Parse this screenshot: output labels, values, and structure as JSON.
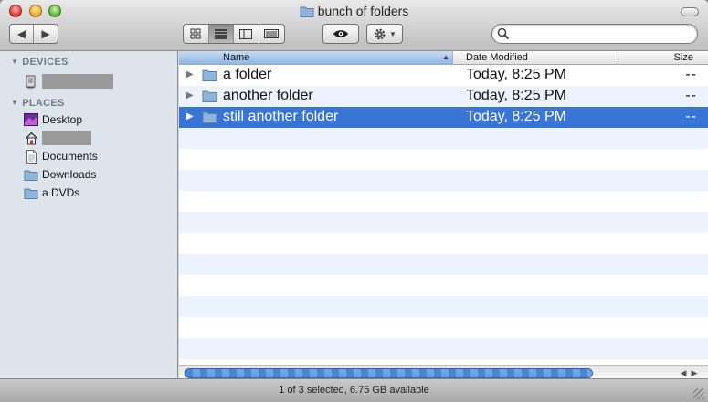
{
  "window": {
    "title": "bunch of folders"
  },
  "toolbar": {
    "back": "◀",
    "forward": "▶",
    "views": [
      "icon-view",
      "list-view",
      "column-view",
      "coverflow-view"
    ],
    "active_view": 1,
    "search": {
      "value": "",
      "placeholder": ""
    }
  },
  "sidebar": {
    "devices_header": "DEVICES",
    "places_header": "PLACES",
    "places": [
      {
        "label": "Desktop",
        "icon": "desktop-icon"
      },
      {
        "label": "",
        "icon": "home-icon"
      },
      {
        "label": "Documents",
        "icon": "document-icon"
      },
      {
        "label": "Downloads",
        "icon": "folder-icon"
      },
      {
        "label": "a DVDs",
        "icon": "folder-icon"
      }
    ]
  },
  "columns": {
    "name": "Name",
    "date": "Date Modified",
    "size": "Size"
  },
  "files": [
    {
      "name": "a folder",
      "date": "Today, 8:25 PM",
      "size": "--",
      "selected": false
    },
    {
      "name": "another folder",
      "date": "Today, 8:25 PM",
      "size": "--",
      "selected": false
    },
    {
      "name": "still another folder",
      "date": "Today, 8:25 PM",
      "size": "--",
      "selected": true
    }
  ],
  "status": {
    "text": "1 of 3 selected, 6.75 GB available"
  },
  "colors": {
    "selection": "#3875d7",
    "stripe": "#edf3fe",
    "sidebar": "#dde4ec"
  }
}
